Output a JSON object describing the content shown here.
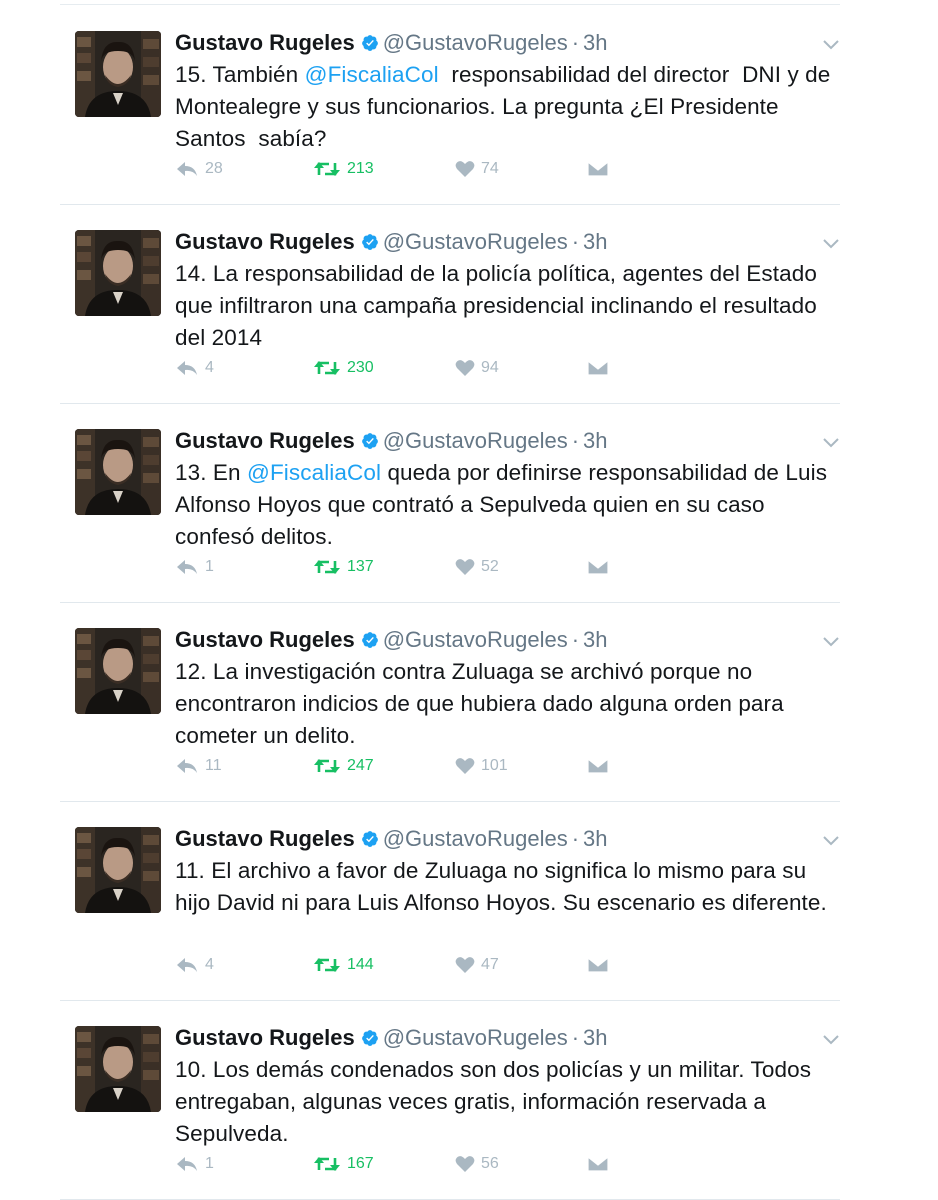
{
  "tweets": [
    {
      "name": "Gustavo Rugeles",
      "handle": "@GustavoRugeles",
      "dot": "·",
      "time": "3h",
      "text_parts": [
        {
          "t": "15. También ",
          "m": false
        },
        {
          "t": "@FiscaliaCol",
          "m": true
        },
        {
          "t": "  responsabilidad del director  DNI y de Montealegre y sus funcionarios. La pregunta ¿El Presidente Santos  sabía?",
          "m": false
        }
      ],
      "replies": "28",
      "retweets": "213",
      "likes": "74"
    },
    {
      "name": "Gustavo Rugeles",
      "handle": "@GustavoRugeles",
      "dot": "·",
      "time": "3h",
      "text_parts": [
        {
          "t": "14. La responsabilidad de la policía política, agentes del Estado que infiltraron una campaña presidencial inclinando el resultado del 2014",
          "m": false
        }
      ],
      "replies": "4",
      "retweets": "230",
      "likes": "94"
    },
    {
      "name": "Gustavo Rugeles",
      "handle": "@GustavoRugeles",
      "dot": "·",
      "time": "3h",
      "text_parts": [
        {
          "t": "13. En ",
          "m": false
        },
        {
          "t": "@FiscaliaCol",
          "m": true
        },
        {
          "t": " queda por definirse responsabilidad de Luis Alfonso Hoyos que contrató a Sepulveda quien en su caso confesó delitos.",
          "m": false
        }
      ],
      "replies": "1",
      "retweets": "137",
      "likes": "52"
    },
    {
      "name": "Gustavo Rugeles",
      "handle": "@GustavoRugeles",
      "dot": "·",
      "time": "3h",
      "text_parts": [
        {
          "t": "12. La investigación contra Zuluaga se archivó porque no encontraron indicios de que hubiera dado alguna orden para cometer un delito.",
          "m": false
        }
      ],
      "replies": "11",
      "retweets": "247",
      "likes": "101"
    },
    {
      "name": "Gustavo Rugeles",
      "handle": "@GustavoRugeles",
      "dot": "·",
      "time": "3h",
      "text_parts": [
        {
          "t": "11. El archivo a favor de Zuluaga no significa lo mismo para su hijo David ni para Luis Alfonso Hoyos. Su escenario es diferente.",
          "m": false
        }
      ],
      "replies": "4",
      "retweets": "144",
      "likes": "47"
    },
    {
      "name": "Gustavo Rugeles",
      "handle": "@GustavoRugeles",
      "dot": "·",
      "time": "3h",
      "text_parts": [
        {
          "t": "10. Los demás condenados son dos policías y un militar. Todos entregaban, algunas veces gratis, información reservada a Sepulveda.",
          "m": false
        }
      ],
      "replies": "1",
      "retweets": "167",
      "likes": "56"
    }
  ],
  "colors": {
    "link": "#1da1f2",
    "retweet": "#17bf63",
    "muted": "#aab8c2",
    "secondary": "#657786",
    "verified": "#1da1f2"
  },
  "icons": [
    "verified-badge-icon",
    "chevron-down-icon",
    "reply-icon",
    "retweet-icon",
    "heart-icon",
    "direct-message-icon"
  ]
}
